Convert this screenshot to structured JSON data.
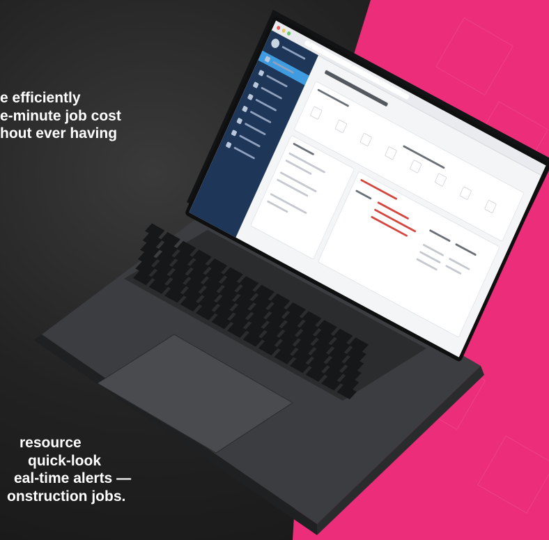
{
  "marketing": {
    "top_lines": [
      "e efficiently",
      "e-minute job cost",
      "hout ever having"
    ],
    "bottom_lines": [
      "resource",
      "quick-look",
      "eal-time alerts —",
      "onstruction jobs."
    ]
  },
  "colors": {
    "accent": "#ec2d7a",
    "sidebar": "#1e3658",
    "sidebar_active": "#3f9ce0",
    "alert_red": "#d5463f"
  },
  "app": {
    "sidebar_icons": [
      "dashboard-icon",
      "jobs-icon",
      "users-icon",
      "reports-icon",
      "documents-icon",
      "calendar-icon",
      "settings-icon",
      "help-icon"
    ]
  }
}
